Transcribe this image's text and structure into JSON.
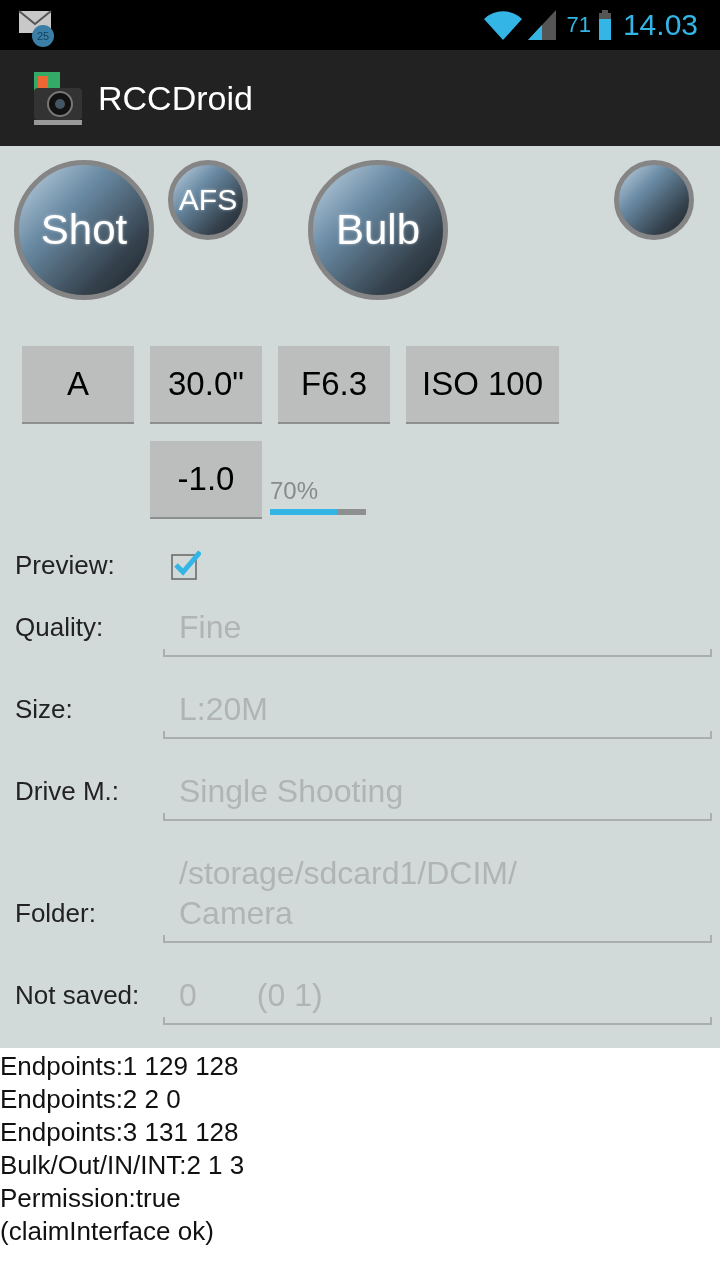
{
  "status_bar": {
    "mail_count": "25",
    "battery_percent": "71",
    "time": "14.03"
  },
  "action_bar": {
    "title": "RCCDroid"
  },
  "round_buttons": [
    {
      "label": "Shot",
      "kind": "large"
    },
    {
      "label": "AFS",
      "kind": "small"
    },
    {
      "label": "Bulb",
      "kind": "large"
    },
    {
      "kind": "small"
    }
  ],
  "setting_buttons": [
    {
      "label": "A"
    },
    {
      "label": "30.0\""
    },
    {
      "label": "F6.3"
    },
    {
      "label": "ISO 100"
    }
  ],
  "exposure_button": {
    "label": "-1.0"
  },
  "battery_meter": {
    "reading": "70%",
    "level": 0.7
  },
  "preview": {
    "label": "Preview:",
    "checked": true
  },
  "fields": [
    {
      "label": "Quality:",
      "values": [
        "Fine"
      ]
    },
    {
      "label": "Size:",
      "values": [
        "L:20M"
      ]
    },
    {
      "label": "Drive M.:",
      "values": [
        "Single Shooting"
      ]
    },
    {
      "label": "Folder:",
      "values": [
        "/storage/sdcard1/DCIM/ Camera"
      ]
    },
    {
      "label": "Not saved:",
      "values": [
        "0",
        "(0 1)"
      ]
    }
  ],
  "log_lines": [
    "Endpoints:1 129 128",
    "Endpoints:2 2 0",
    "Endpoints:3 131 128",
    "Bulk/Out/IN/INT:2 1 3",
    "Permission:true",
    "(claimInterface ok)"
  ]
}
